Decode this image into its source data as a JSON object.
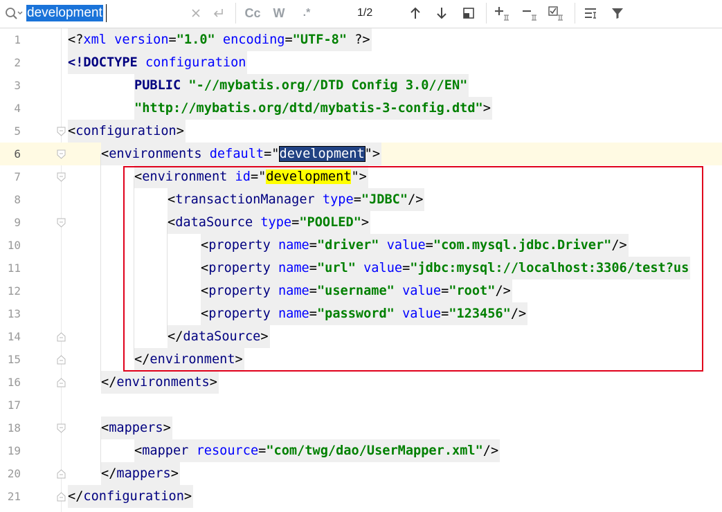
{
  "search": {
    "query": "development",
    "match_count": "1/2",
    "case_label": "Cc",
    "word_label": "W",
    "regex_label": ".*"
  },
  "editor": {
    "current_line": 6,
    "lines": [
      {
        "n": "1",
        "tokens": [
          {
            "c": "br",
            "t": "<?"
          },
          {
            "c": "attr",
            "t": "xml version"
          },
          {
            "c": "br",
            "t": "="
          },
          {
            "c": "val",
            "t": "\"1.0\""
          },
          {
            "c": "attr",
            "t": " encoding"
          },
          {
            "c": "br",
            "t": "="
          },
          {
            "c": "val",
            "t": "\"UTF-8\""
          },
          {
            "c": "br",
            "t": " ?>"
          }
        ]
      },
      {
        "n": "2",
        "tokens": [
          {
            "c": "kw",
            "t": "<!DOCTYPE "
          },
          {
            "c": "attr",
            "t": "configuration"
          }
        ]
      },
      {
        "n": "3",
        "tokens": [
          {
            "c": "kw",
            "t": "PUBLIC "
          },
          {
            "c": "val",
            "t": "\"-//mybatis.org//DTD Config 3.0//EN\""
          }
        ]
      },
      {
        "n": "4",
        "tokens": [
          {
            "c": "val",
            "t": "\"http://mybatis.org/dtd/mybatis-3-config.dtd\""
          },
          {
            "c": "br",
            "t": ">"
          }
        ]
      },
      {
        "n": "5",
        "tokens": [
          {
            "c": "br",
            "t": "<"
          },
          {
            "c": "tag",
            "t": "configuration"
          },
          {
            "c": "br",
            "t": ">"
          }
        ]
      },
      {
        "n": "6",
        "tokens": [
          {
            "c": "br",
            "t": "<"
          },
          {
            "c": "tag",
            "t": "environments "
          },
          {
            "c": "attr",
            "t": "default"
          },
          {
            "c": "br",
            "t": "=\""
          },
          {
            "c": "sel",
            "t": "development"
          },
          {
            "c": "br",
            "t": "\">"
          }
        ]
      },
      {
        "n": "7",
        "tokens": [
          {
            "c": "br",
            "t": "<"
          },
          {
            "c": "tag",
            "t": "environment "
          },
          {
            "c": "attr",
            "t": "id"
          },
          {
            "c": "br",
            "t": "=\""
          },
          {
            "c": "yel",
            "t": "development"
          },
          {
            "c": "br",
            "t": "\">"
          }
        ]
      },
      {
        "n": "8",
        "tokens": [
          {
            "c": "br",
            "t": "<"
          },
          {
            "c": "tag",
            "t": "transactionManager "
          },
          {
            "c": "attr",
            "t": "type"
          },
          {
            "c": "br",
            "t": "="
          },
          {
            "c": "val",
            "t": "\"JDBC\""
          },
          {
            "c": "br",
            "t": "/>"
          }
        ]
      },
      {
        "n": "9",
        "tokens": [
          {
            "c": "br",
            "t": "<"
          },
          {
            "c": "tag",
            "t": "dataSource "
          },
          {
            "c": "attr",
            "t": "type"
          },
          {
            "c": "br",
            "t": "="
          },
          {
            "c": "val",
            "t": "\"POOLED\""
          },
          {
            "c": "br",
            "t": ">"
          }
        ]
      },
      {
        "n": "10",
        "tokens": [
          {
            "c": "br",
            "t": "<"
          },
          {
            "c": "tag",
            "t": "property "
          },
          {
            "c": "attr",
            "t": "name"
          },
          {
            "c": "br",
            "t": "="
          },
          {
            "c": "val",
            "t": "\"driver\""
          },
          {
            "c": "attr",
            "t": " value"
          },
          {
            "c": "br",
            "t": "="
          },
          {
            "c": "val",
            "t": "\"com.mysql.jdbc.Driver\""
          },
          {
            "c": "br",
            "t": "/>"
          }
        ]
      },
      {
        "n": "11",
        "tokens": [
          {
            "c": "br",
            "t": "<"
          },
          {
            "c": "tag",
            "t": "property "
          },
          {
            "c": "attr",
            "t": "name"
          },
          {
            "c": "br",
            "t": "="
          },
          {
            "c": "val",
            "t": "\"url\""
          },
          {
            "c": "attr",
            "t": " value"
          },
          {
            "c": "br",
            "t": "="
          },
          {
            "c": "val",
            "t": "\"jdbc:mysql://localhost:3306/test?us"
          }
        ]
      },
      {
        "n": "12",
        "tokens": [
          {
            "c": "br",
            "t": "<"
          },
          {
            "c": "tag",
            "t": "property "
          },
          {
            "c": "attr",
            "t": "name"
          },
          {
            "c": "br",
            "t": "="
          },
          {
            "c": "val",
            "t": "\"username\""
          },
          {
            "c": "attr",
            "t": " value"
          },
          {
            "c": "br",
            "t": "="
          },
          {
            "c": "val",
            "t": "\"root\""
          },
          {
            "c": "br",
            "t": "/>"
          }
        ]
      },
      {
        "n": "13",
        "tokens": [
          {
            "c": "br",
            "t": "<"
          },
          {
            "c": "tag",
            "t": "property "
          },
          {
            "c": "attr",
            "t": "name"
          },
          {
            "c": "br",
            "t": "="
          },
          {
            "c": "val",
            "t": "\"password\""
          },
          {
            "c": "attr",
            "t": " value"
          },
          {
            "c": "br",
            "t": "="
          },
          {
            "c": "val",
            "t": "\"123456\""
          },
          {
            "c": "br",
            "t": "/>"
          }
        ]
      },
      {
        "n": "14",
        "tokens": [
          {
            "c": "br",
            "t": "</"
          },
          {
            "c": "tag",
            "t": "dataSource"
          },
          {
            "c": "br",
            "t": ">"
          }
        ]
      },
      {
        "n": "15",
        "tokens": [
          {
            "c": "br",
            "t": "</"
          },
          {
            "c": "tag",
            "t": "environment"
          },
          {
            "c": "br",
            "t": ">"
          }
        ]
      },
      {
        "n": "16",
        "tokens": [
          {
            "c": "br",
            "t": "</"
          },
          {
            "c": "tag",
            "t": "environments"
          },
          {
            "c": "br",
            "t": ">"
          }
        ]
      },
      {
        "n": "17",
        "tokens": []
      },
      {
        "n": "18",
        "tokens": [
          {
            "c": "br",
            "t": "<"
          },
          {
            "c": "tag",
            "t": "mappers"
          },
          {
            "c": "br",
            "t": ">"
          }
        ]
      },
      {
        "n": "19",
        "tokens": [
          {
            "c": "br",
            "t": "<"
          },
          {
            "c": "tag",
            "t": "mapper "
          },
          {
            "c": "attr",
            "t": "resource"
          },
          {
            "c": "br",
            "t": "="
          },
          {
            "c": "val",
            "t": "\"com/twg/dao/UserMapper.xml\""
          },
          {
            "c": "br",
            "t": "/>"
          }
        ]
      },
      {
        "n": "20",
        "tokens": [
          {
            "c": "br",
            "t": "</"
          },
          {
            "c": "tag",
            "t": "mappers"
          },
          {
            "c": "br",
            "t": ">"
          }
        ]
      },
      {
        "n": "21",
        "tokens": [
          {
            "c": "br",
            "t": "</"
          },
          {
            "c": "tag",
            "t": "configuration"
          },
          {
            "c": "br",
            "t": ">"
          }
        ]
      }
    ]
  },
  "colors": {
    "search_selection": "#1a73d9",
    "current_line": "#fffae3",
    "match_highlight": "#ffff00",
    "selected_match": "#214283",
    "annotation_box": "#e0001b"
  }
}
